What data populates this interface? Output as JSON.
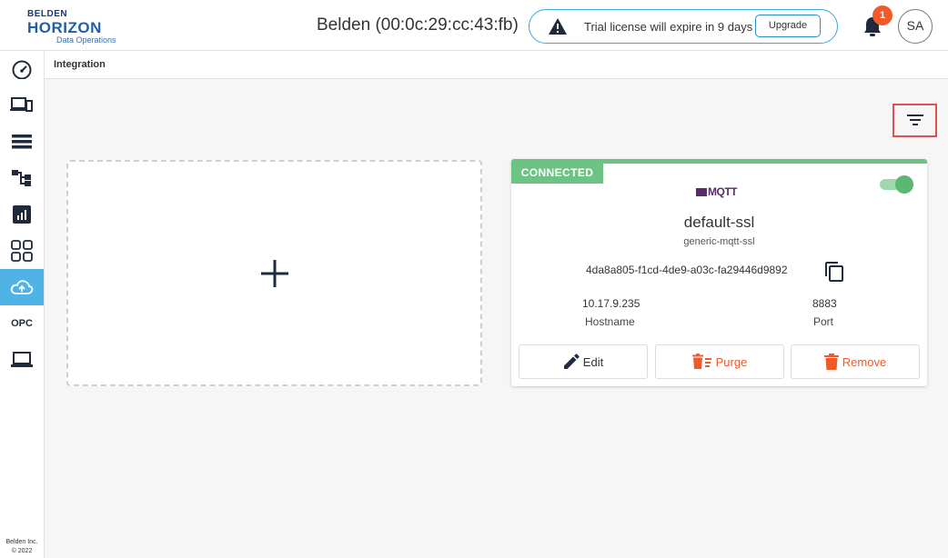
{
  "header": {
    "logo": {
      "line1": "BELDEN",
      "line2": "HORIZON",
      "line3": "Data Operations"
    },
    "device_title": "Belden (00:0c:29:cc:43:fb)",
    "license_text": "Trial license will expire in 9 days",
    "upgrade_label": "Upgrade",
    "notification_count": "1",
    "avatar_initials": "SA"
  },
  "sidebar": {
    "items": [
      {
        "id": "dashboard",
        "icon": "gauge-icon"
      },
      {
        "id": "devices",
        "icon": "devices-icon"
      },
      {
        "id": "list",
        "icon": "list-icon"
      },
      {
        "id": "topology",
        "icon": "hierarchy-icon"
      },
      {
        "id": "reports",
        "icon": "chart-icon"
      },
      {
        "id": "apps",
        "icon": "grid-icon"
      },
      {
        "id": "integration",
        "icon": "cloud-upload-icon",
        "active": true
      },
      {
        "id": "opc",
        "label": "OPC"
      },
      {
        "id": "computer",
        "icon": "laptop-icon"
      }
    ],
    "footer_line1": "Belden Inc.",
    "footer_line2": "© 2022"
  },
  "breadcrumb": "Integration",
  "card": {
    "status": "CONNECTED",
    "brand": "MQTT",
    "name": "default-ssl",
    "type": "generic-mqtt-ssl",
    "id": "4da8a805-f1cd-4de9-a03c-fa29446d9892",
    "hostname_value": "10.17.9.235",
    "hostname_label": "Hostname",
    "port_value": "8883",
    "port_label": "Port",
    "enabled": true,
    "actions": {
      "edit": "Edit",
      "purge": "Purge",
      "remove": "Remove"
    }
  },
  "colors": {
    "accent": "#4fb3e6",
    "connected": "#6cc383",
    "danger": "#ee5a2a",
    "badge": "#f05a28"
  }
}
